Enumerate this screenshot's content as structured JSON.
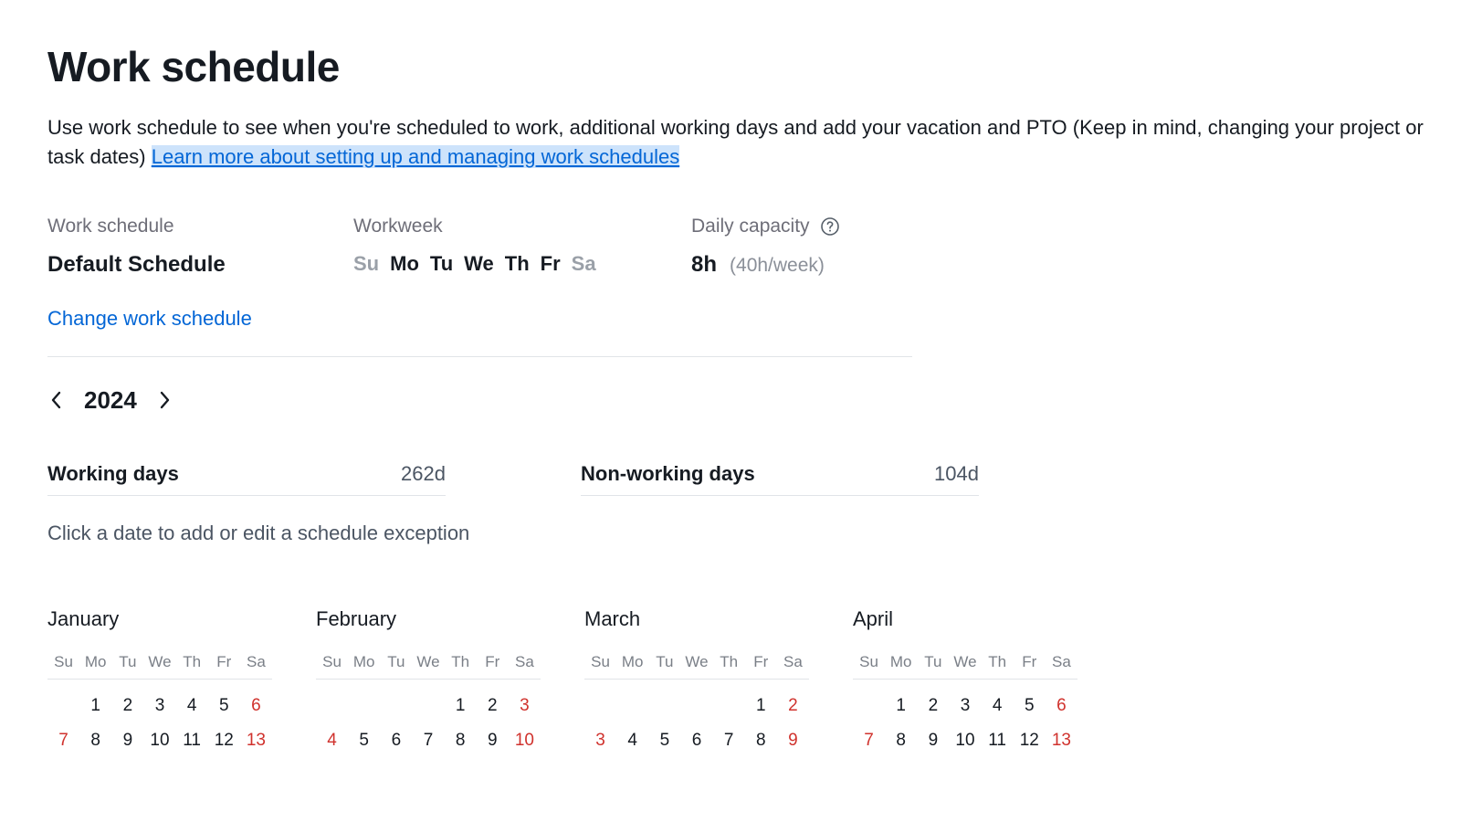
{
  "title": "Work schedule",
  "intro_text": "Use work schedule to see when you're scheduled to work, additional working days and add your vacation and PTO (Keep in mind, changing your project or task dates) ",
  "intro_link": "Learn more about setting up and managing work schedules",
  "meta": {
    "schedule_label": "Work schedule",
    "schedule_value": "Default Schedule",
    "change_link": "Change work schedule",
    "workweek_label": "Workweek",
    "workweek_days": [
      {
        "abbr": "Su",
        "active": false
      },
      {
        "abbr": "Mo",
        "active": true
      },
      {
        "abbr": "Tu",
        "active": true
      },
      {
        "abbr": "We",
        "active": true
      },
      {
        "abbr": "Th",
        "active": true
      },
      {
        "abbr": "Fr",
        "active": true
      },
      {
        "abbr": "Sa",
        "active": false
      }
    ],
    "capacity_label": "Daily capacity",
    "capacity_value": "8h",
    "capacity_note": "(40h/week)"
  },
  "year": "2024",
  "stats": {
    "working_label": "Working days",
    "working_value": "262d",
    "nonworking_label": "Non-working days",
    "nonworking_value": "104d"
  },
  "hint": "Click a date to add or edit a schedule exception",
  "day_headers": [
    "Su",
    "Mo",
    "Tu",
    "We",
    "Th",
    "Fr",
    "Sa"
  ],
  "months": [
    {
      "name": "January",
      "rows": [
        [
          {
            "n": ""
          },
          {
            "n": "1"
          },
          {
            "n": "2"
          },
          {
            "n": "3"
          },
          {
            "n": "4"
          },
          {
            "n": "5"
          },
          {
            "n": "6",
            "red": true
          }
        ],
        [
          {
            "n": "7",
            "red": true
          },
          {
            "n": "8"
          },
          {
            "n": "9"
          },
          {
            "n": "10"
          },
          {
            "n": "11"
          },
          {
            "n": "12"
          },
          {
            "n": "13",
            "red": true
          }
        ]
      ]
    },
    {
      "name": "February",
      "rows": [
        [
          {
            "n": ""
          },
          {
            "n": ""
          },
          {
            "n": ""
          },
          {
            "n": ""
          },
          {
            "n": "1"
          },
          {
            "n": "2"
          },
          {
            "n": "3",
            "red": true
          }
        ],
        [
          {
            "n": "4",
            "red": true
          },
          {
            "n": "5"
          },
          {
            "n": "6"
          },
          {
            "n": "7"
          },
          {
            "n": "8"
          },
          {
            "n": "9"
          },
          {
            "n": "10",
            "red": true
          }
        ]
      ]
    },
    {
      "name": "March",
      "rows": [
        [
          {
            "n": ""
          },
          {
            "n": ""
          },
          {
            "n": ""
          },
          {
            "n": ""
          },
          {
            "n": ""
          },
          {
            "n": "1"
          },
          {
            "n": "2",
            "red": true
          }
        ],
        [
          {
            "n": "3",
            "red": true
          },
          {
            "n": "4"
          },
          {
            "n": "5"
          },
          {
            "n": "6"
          },
          {
            "n": "7"
          },
          {
            "n": "8"
          },
          {
            "n": "9",
            "red": true
          }
        ]
      ]
    },
    {
      "name": "April",
      "rows": [
        [
          {
            "n": ""
          },
          {
            "n": "1"
          },
          {
            "n": "2"
          },
          {
            "n": "3"
          },
          {
            "n": "4"
          },
          {
            "n": "5"
          },
          {
            "n": "6",
            "red": true
          }
        ],
        [
          {
            "n": "7",
            "red": true
          },
          {
            "n": "8"
          },
          {
            "n": "9"
          },
          {
            "n": "10"
          },
          {
            "n": "11"
          },
          {
            "n": "12"
          },
          {
            "n": "13",
            "red": true
          }
        ]
      ]
    }
  ]
}
